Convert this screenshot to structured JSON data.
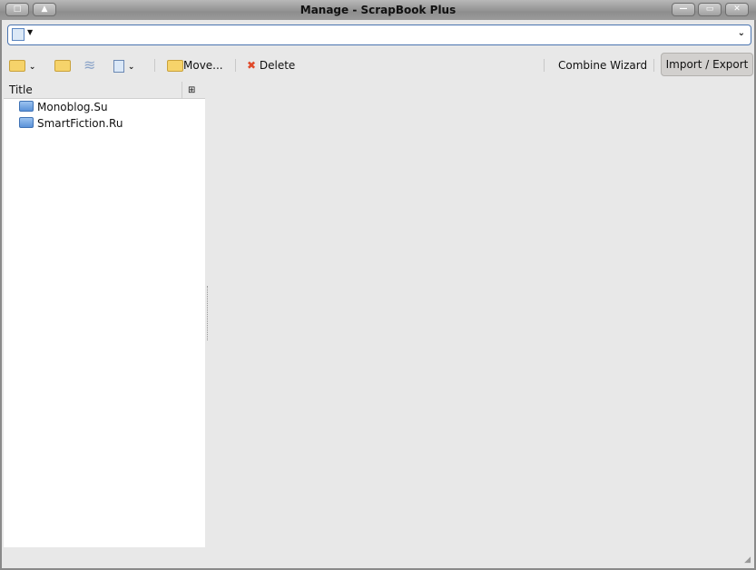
{
  "window": {
    "title": "Manage - ScrapBook Plus"
  },
  "search": {
    "value": "",
    "placeholder": ""
  },
  "toolbar": {
    "move": "Move...",
    "delete": "Delete",
    "combine": "Combine Wizard",
    "import_export": "Import / Export"
  },
  "tree": {
    "column": "Title",
    "items": [
      {
        "label": "Monoblog.Su"
      },
      {
        "label": "SmartFiction.Ru"
      }
    ]
  }
}
